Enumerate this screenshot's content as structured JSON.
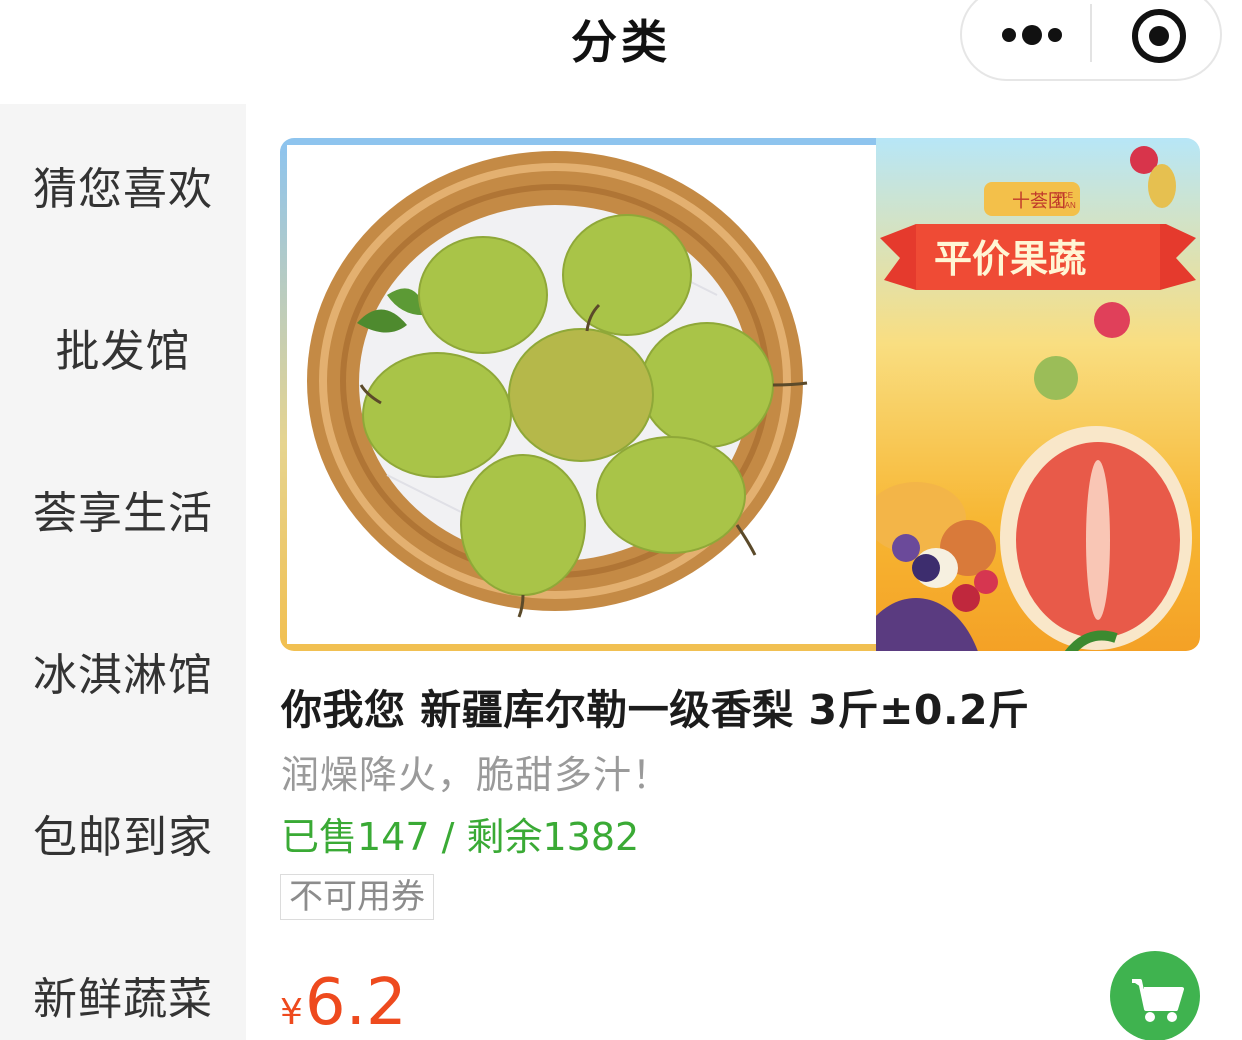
{
  "header": {
    "title": "分类"
  },
  "sidebar": {
    "items": [
      {
        "label": "猜您喜欢"
      },
      {
        "label": "批发馆"
      },
      {
        "label": "荟享生活"
      },
      {
        "label": "冰淇淋馆"
      },
      {
        "label": "包邮到家"
      },
      {
        "label": "新鲜蔬菜"
      }
    ]
  },
  "banner": {
    "brand": "十荟团",
    "brand_sub": [
      "NICE",
      "TUAN"
    ],
    "slogan": "平价果蔬"
  },
  "product": {
    "title": "你我您 新疆库尔勒一级香梨 3斤±0.2斤",
    "subtitle": "润燥降火，脆甜多汁！",
    "sales": "已售147 / 剩余1382",
    "coupon": "不可用券",
    "currency": "¥",
    "price": "6.2"
  },
  "colors": {
    "accent_green": "#3aaa35",
    "price_red": "#ee4a1e",
    "cart_green": "#3fb34f",
    "sidebar_bg": "#f5f5f5"
  },
  "icons": {
    "more": "more-dots-icon",
    "close": "target-icon",
    "cart": "cart-icon"
  }
}
